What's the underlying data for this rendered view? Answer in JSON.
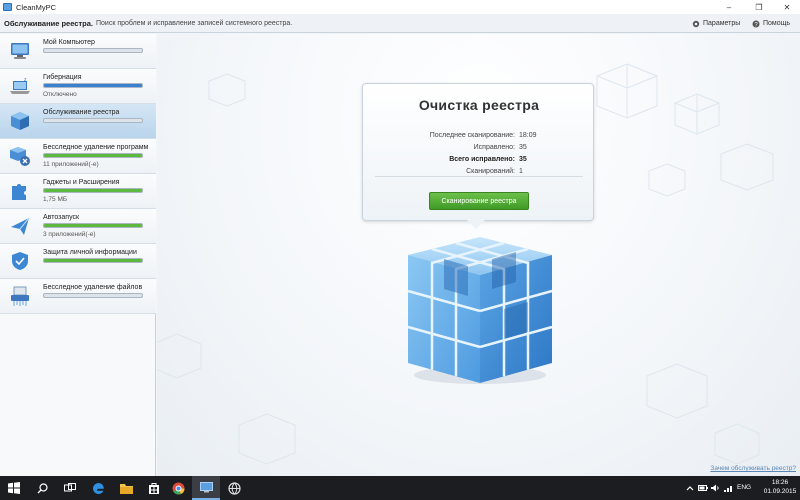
{
  "window": {
    "title": "CleanMyPC",
    "minimize_glyph": "–",
    "maximize_glyph": "❐",
    "close_glyph": "✕"
  },
  "header": {
    "title": "Обслуживание реестра.",
    "description": "Поиск проблем и исправление записей системного реестра.",
    "settings_label": "Параметры",
    "help_label": "Помощь"
  },
  "sidebar": {
    "items": [
      {
        "label": "Мой Компьютер",
        "subtext": "",
        "progress": 0.0,
        "bar_color": "#dde3e9",
        "icon": "computer-icon"
      },
      {
        "label": "Гибернация",
        "subtext": "Отключено",
        "progress": 1.0,
        "bar_color": "#3b7fd0",
        "icon": "laptop-sleep-icon"
      },
      {
        "label": "Обслуживание реестра",
        "subtext": "",
        "progress": 0.0,
        "bar_color": "#dde3e9",
        "icon": "registry-cube-icon",
        "active": true
      },
      {
        "label": "Бесследное удаление программ",
        "subtext": "11 приложений(-е)",
        "progress": 1.0,
        "bar_color": "#5cb83f",
        "icon": "uninstall-icon"
      },
      {
        "label": "Гаджеты и Расширения",
        "subtext": "1,75 МБ",
        "progress": 1.0,
        "bar_color": "#5cb83f",
        "icon": "puzzle-icon"
      },
      {
        "label": "Автозапуск",
        "subtext": "3 приложений(-е)",
        "progress": 1.0,
        "bar_color": "#5cb83f",
        "icon": "autorun-plane-icon"
      },
      {
        "label": "Защита личной информации",
        "subtext": "",
        "progress": 1.0,
        "bar_color": "#5cb83f",
        "icon": "shield-icon"
      },
      {
        "label": "Бесследное удаление файлов",
        "subtext": "",
        "progress": 0.0,
        "bar_color": "#dde3e9",
        "icon": "shredder-icon"
      }
    ]
  },
  "panel": {
    "title": "Очистка реестра",
    "stats": [
      {
        "label": "Последнее сканирование:",
        "value": "18:09",
        "bold": false
      },
      {
        "label": "Исправлено:",
        "value": "35",
        "bold": false
      },
      {
        "label": "Всего исправлено:",
        "value": "35",
        "bold": true
      },
      {
        "label": "Сканирований:",
        "value": "1",
        "bold": false
      }
    ],
    "scan_button_label": "Сканирование реестра"
  },
  "footer_link": "Зачем обслуживать реестр?",
  "taskbar": {
    "icons": [
      "windows-start-icon",
      "search-icon",
      "task-view-icon",
      "edge-browser-icon",
      "file-explorer-icon",
      "store-icon",
      "chrome-icon",
      "cleanmypc-icon",
      "network-globe-icon"
    ],
    "tray_icons": [
      "chevron-up-icon",
      "battery-icon",
      "volume-icon",
      "network-icon"
    ],
    "language": "ENG",
    "time": "18:26",
    "date": "01.09.2015"
  },
  "colors": {
    "accent_green": "#4ea932",
    "accent_blue": "#3b7fd0",
    "cube_blue": "#6fb0e4"
  }
}
